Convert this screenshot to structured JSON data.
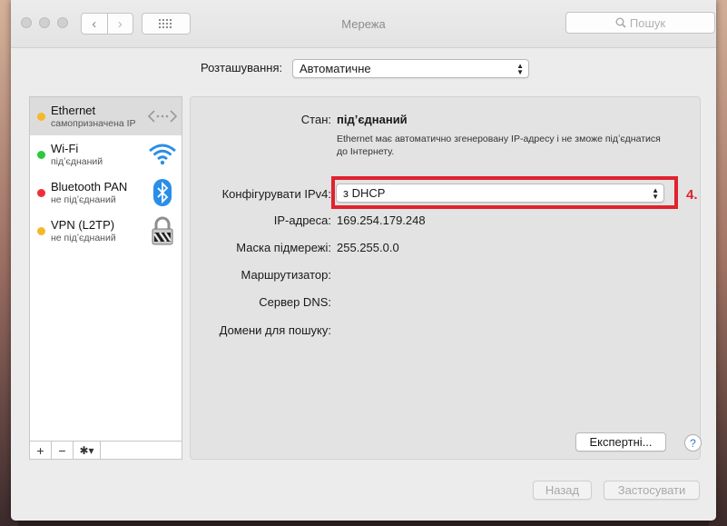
{
  "window": {
    "title": "Мережа"
  },
  "toolbar": {
    "back": "‹",
    "forward": "›",
    "search_placeholder": "Пошук"
  },
  "location": {
    "label": "Розташування:",
    "value": "Автоматичне"
  },
  "services": [
    {
      "name": "Ethernet",
      "status": "самопризначена IP",
      "dot_color": "#f5b829",
      "icon": "ethernet-icon"
    },
    {
      "name": "Wi-Fi",
      "status": "підʼєднаний",
      "dot_color": "#2bc840",
      "icon": "wifi-icon"
    },
    {
      "name": "Bluetooth PAN",
      "status": "не підʼєднаний",
      "dot_color": "#ef2f3b",
      "icon": "bluetooth-icon"
    },
    {
      "name": "VPN (L2TP)",
      "status": "не підʼєднаний",
      "dot_color": "#f5b829",
      "icon": "vpn-lock-icon"
    }
  ],
  "sidebar_tools": {
    "add": "+",
    "remove": "−",
    "gear": "✱▾"
  },
  "details": {
    "status_label": "Стан:",
    "status_value": "підʼєднаний",
    "status_note": "Ethernet має автоматично згенеровану IP-адресу і не зможе підʼєднатися до Інтернету.",
    "ipv4_label": "Конфігурувати IPv4:",
    "ipv4_value": "з DHCP",
    "ip_label": "IP-адреса:",
    "ip_value": "169.254.179.248",
    "mask_label": "Маска підмережі:",
    "mask_value": "255.255.0.0",
    "router_label": "Маршрутизатор:",
    "dns_label": "Сервер DNS:",
    "domains_label": "Домени для пошуку:"
  },
  "annotation": {
    "step": "4.",
    "color": "#e0222e"
  },
  "buttons": {
    "advanced": "Експертні...",
    "help": "?",
    "revert": "Назад",
    "apply": "Застосувати"
  }
}
